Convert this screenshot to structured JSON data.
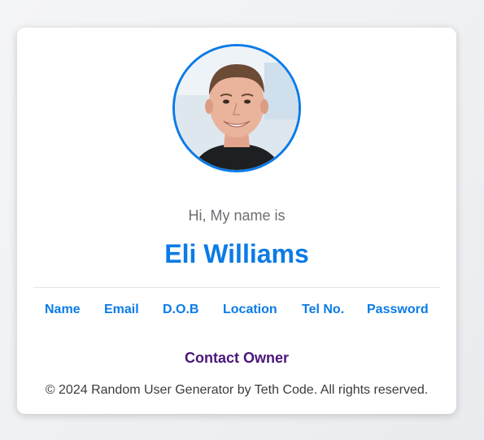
{
  "profile": {
    "greeting": "Hi, My name is",
    "name": "Eli Williams",
    "avatar_alt": "User avatar"
  },
  "tabs": [
    {
      "label": "Name"
    },
    {
      "label": "Email"
    },
    {
      "label": "D.O.B"
    },
    {
      "label": "Location"
    },
    {
      "label": "Tel No."
    },
    {
      "label": "Password"
    }
  ],
  "contact": {
    "label": "Contact Owner"
  },
  "footer": {
    "text": "© 2024 Random User Generator by Teth Code. All rights reserved."
  },
  "colors": {
    "accent": "#0b7be6",
    "contact": "#4a1678",
    "muted_text": "#6b6f73",
    "card_bg": "#ffffff"
  }
}
